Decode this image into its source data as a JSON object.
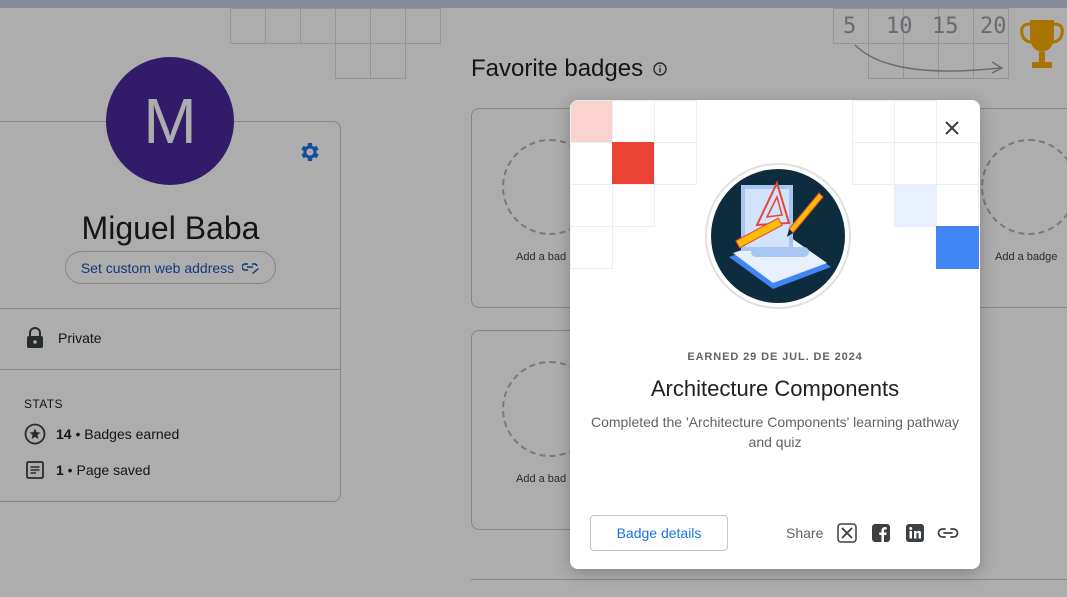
{
  "profile": {
    "avatar_letter": "M",
    "name": "Miguel Baba",
    "custom_address_label": "Set custom web address",
    "privacy_label": "Private",
    "stats_heading": "STATS",
    "stats": [
      {
        "count": "14",
        "label": "Badges earned",
        "icon": "star-circle-icon"
      },
      {
        "count": "1",
        "label": "Page saved",
        "icon": "document-icon"
      }
    ]
  },
  "favorites": {
    "title": "Favorite badges",
    "slot_label": "Add a badge",
    "partial_slot_label": "Add a bad"
  },
  "background_decoration": {
    "numbers": [
      "5",
      "10",
      "15",
      "20"
    ]
  },
  "modal": {
    "earned_text": "EARNED 29 DE JUL. DE 2024",
    "title": "Architecture Components",
    "description": "Completed the 'Architecture Components' learning pathway and quiz",
    "details_button": "Badge details",
    "share_label": "Share",
    "share_icons": [
      "x-icon",
      "facebook-icon",
      "linkedin-icon",
      "link-icon"
    ]
  },
  "colors": {
    "avatar": "#4a2a9c",
    "link_blue": "#1a73e8",
    "accent_red": "#ea4335",
    "accent_blue": "#4285f4",
    "pale_red": "#fad2cf",
    "pale_blue": "#e8f0fe",
    "badge_dark": "#0d2d3e"
  }
}
